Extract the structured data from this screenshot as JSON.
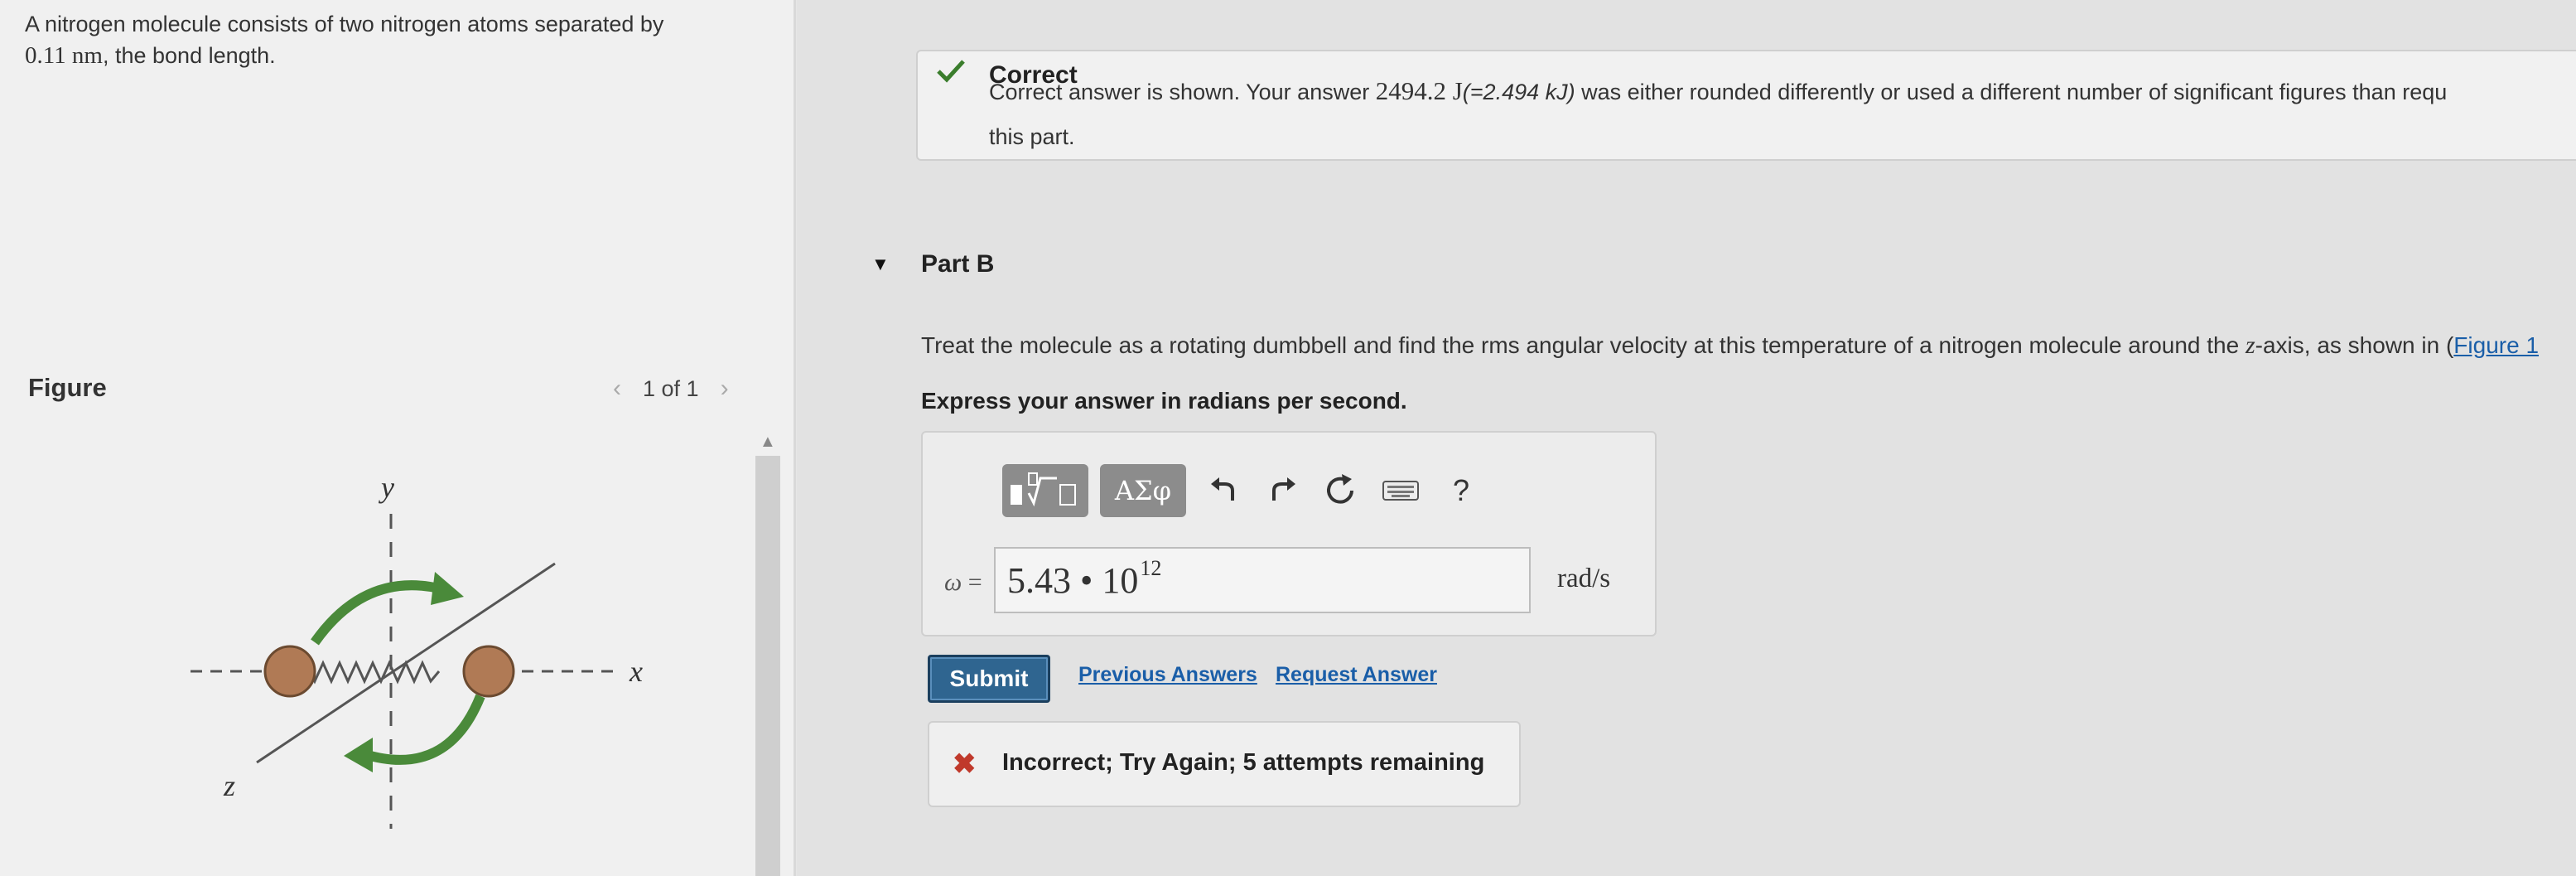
{
  "problem": {
    "text_before": "A nitrogen molecule consists of two nitrogen atoms separated by",
    "value": "0.11 nm",
    "text_after": ", the bond length."
  },
  "figure": {
    "label": "Figure",
    "pager": "1 of 1",
    "axis_y": "y",
    "axis_x": "x",
    "axis_z": "z"
  },
  "part_a_feedback": {
    "status": "Correct",
    "msg_prefix": "Correct answer is shown. Your answer ",
    "answer_value": "2494.2 J",
    "answer_alt": "(=2.494 kJ)",
    "msg_suffix": " was either rounded differently or used a different number of significant figures than requ",
    "msg_line2": "this part."
  },
  "part_b": {
    "title": "Part B",
    "question_prefix": "Treat the molecule as a rotating dumbbell and find the rms angular velocity at this temperature of a nitrogen molecule around the ",
    "question_var": "z",
    "question_mid": "-axis, as shown in (",
    "question_link": "Figure 1",
    "instruction": "Express your answer in radians per second.",
    "toolbar": {
      "templates_icon": "templates-icon",
      "symbols_label": "ΑΣφ",
      "undo_icon": "undo-icon",
      "redo_icon": "redo-icon",
      "reset_icon": "reset-icon",
      "keyboard_icon": "keyboard-icon",
      "help_label": "?"
    },
    "variable": "ω",
    "equals": " =",
    "answer_mantissa": "5.43 • 10",
    "answer_exponent": "12",
    "unit": "rad/s",
    "submit_label": "Submit",
    "previous_answers_label": "Previous Answers",
    "request_answer_label": "Request Answer",
    "feedback": "Incorrect; Try Again; 5 attempts remaining"
  },
  "colors": {
    "correct_check": "#3a7d2c",
    "incorrect_x": "#c0392b",
    "arrow_green": "#4a8a3a",
    "atom": "#b07a55",
    "submit_bg": "#2f6590",
    "link": "#1a5ea8"
  }
}
